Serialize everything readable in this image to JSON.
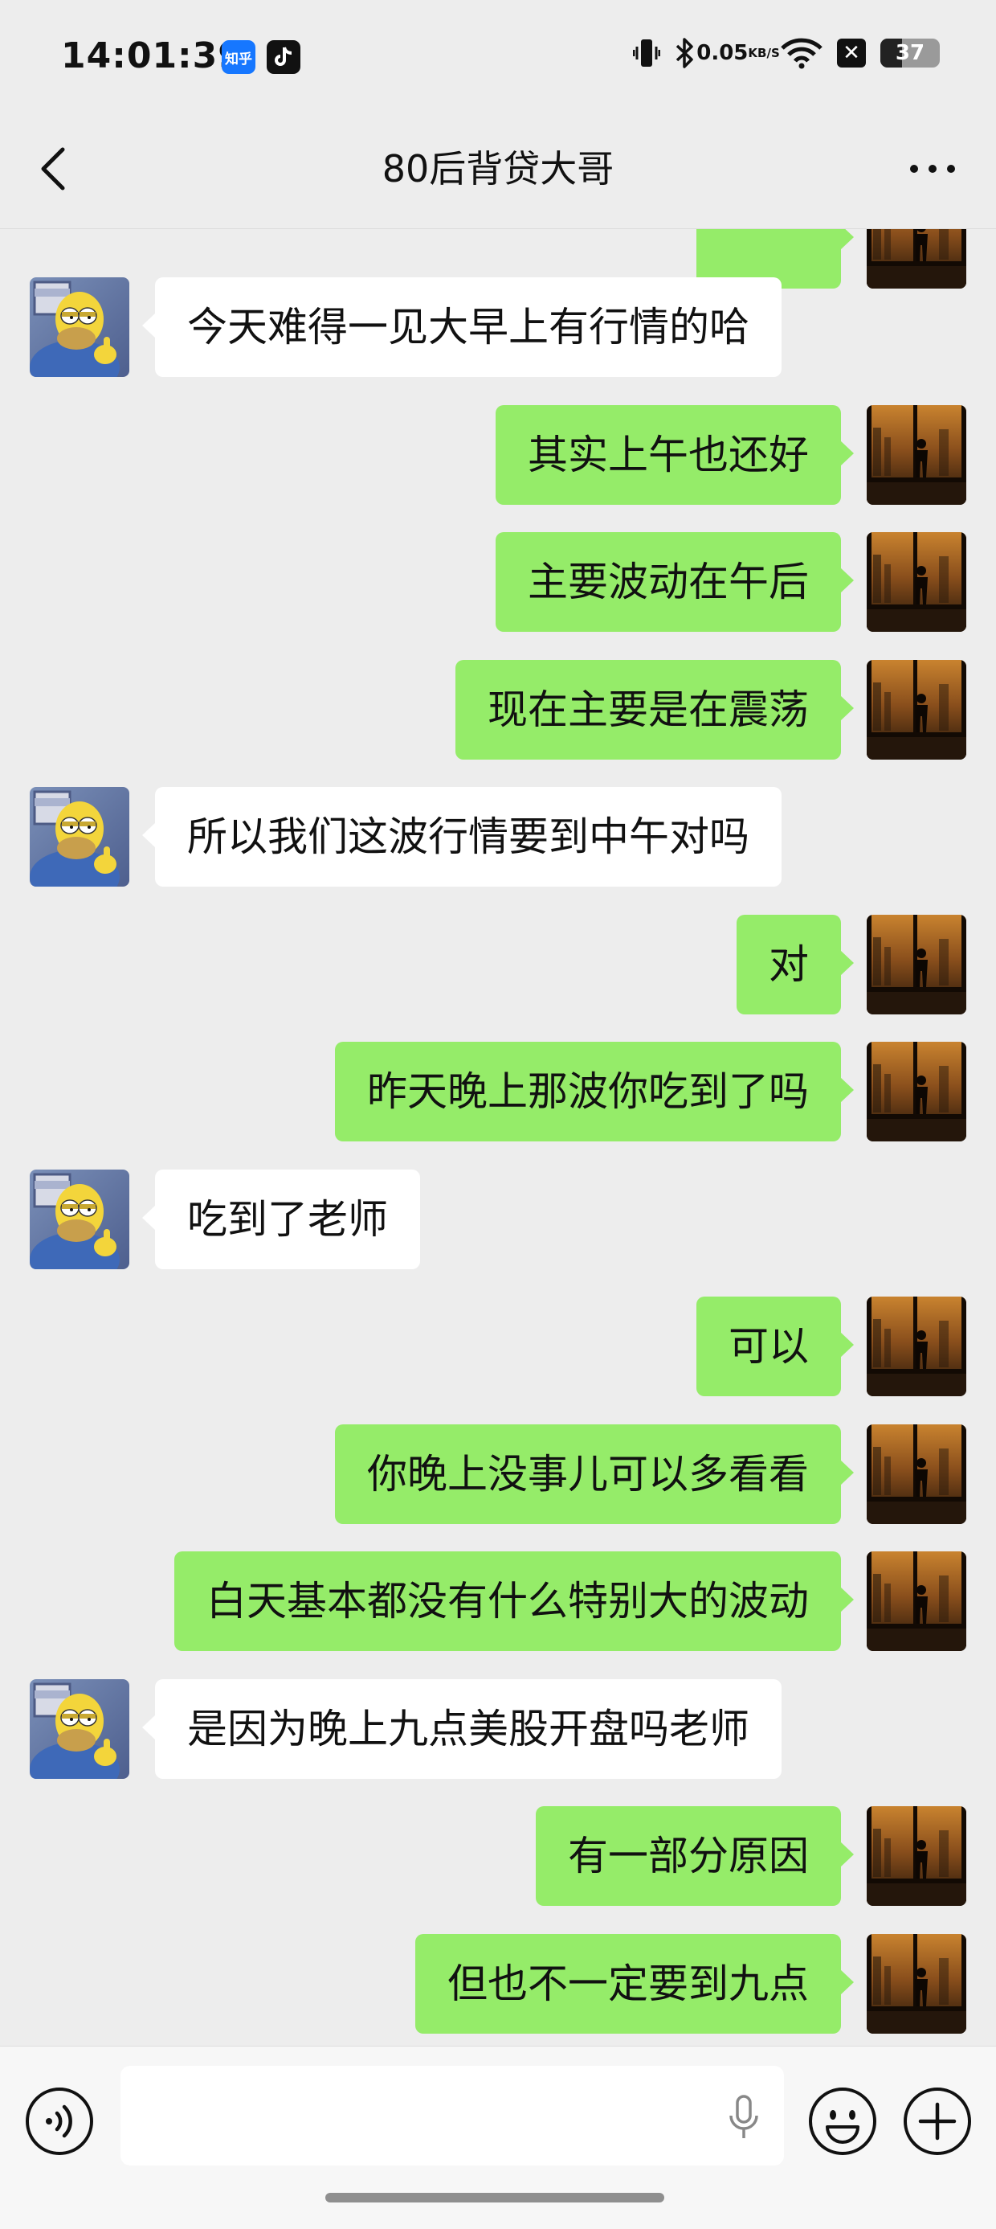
{
  "status_bar": {
    "time": "14:01:39",
    "net_speed_value": "0.05",
    "net_speed_unit": "KB/S",
    "battery_level": "37",
    "battery_fraction": 0.37,
    "app_badges": [
      "知乎",
      "tiktok-icon"
    ]
  },
  "header": {
    "title": "80后背贷大哥"
  },
  "colors": {
    "sent_bubble": "#95ec69",
    "received_bubble": "#ffffff",
    "background": "#ededed"
  },
  "messages": [
    {
      "side": "left",
      "text": "今天难得一见大早上有行情的哈"
    },
    {
      "side": "right",
      "text": "其实上午也还好"
    },
    {
      "side": "right",
      "text": "主要波动在午后"
    },
    {
      "side": "right",
      "text": "现在主要是在震荡"
    },
    {
      "side": "left",
      "text": "所以我们这波行情要到中午对吗"
    },
    {
      "side": "right",
      "text": "对"
    },
    {
      "side": "right",
      "text": "昨天晚上那波你吃到了吗"
    },
    {
      "side": "left",
      "text": "吃到了老师"
    },
    {
      "side": "right",
      "text": "可以"
    },
    {
      "side": "right",
      "text": "你晚上没事儿可以多看看"
    },
    {
      "side": "right",
      "text": "白天基本都没有什么特别大的波动"
    },
    {
      "side": "left",
      "text": "是因为晚上九点美股开盘吗老师"
    },
    {
      "side": "right",
      "text": "有一部分原因"
    },
    {
      "side": "right",
      "text": "但也不一定要到九点"
    }
  ],
  "input_bar": {
    "icons": [
      "voice-icon",
      "mic-icon",
      "emoji-icon",
      "plus-icon"
    ]
  }
}
